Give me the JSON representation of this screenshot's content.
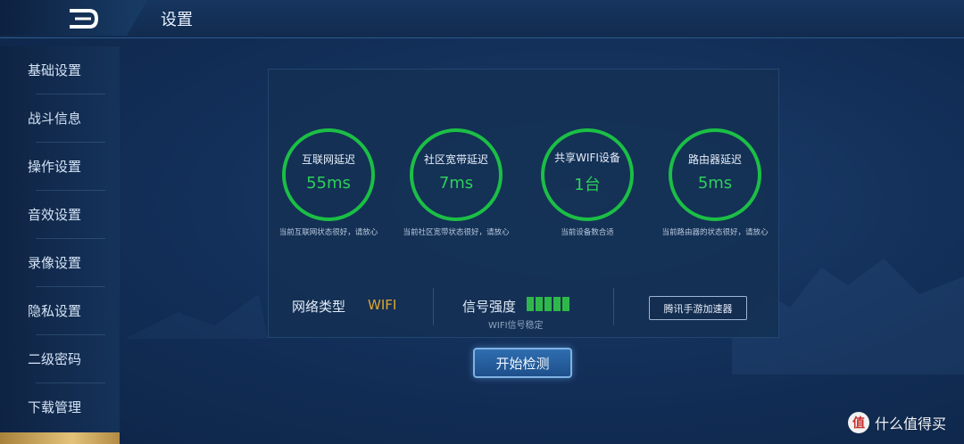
{
  "header": {
    "title": "设置",
    "back_icon": "back-arrow-icon"
  },
  "sidebar": {
    "items": [
      {
        "label": "基础设置"
      },
      {
        "label": "战斗信息"
      },
      {
        "label": "操作设置"
      },
      {
        "label": "音效设置"
      },
      {
        "label": "录像设置"
      },
      {
        "label": "隐私设置"
      },
      {
        "label": "二级密码"
      },
      {
        "label": "下载管理"
      }
    ]
  },
  "metrics": [
    {
      "label": "互联网延迟",
      "value": "55ms",
      "desc": "当前互联网状态很好，请放心"
    },
    {
      "label": "社区宽带延迟",
      "value": "7ms",
      "desc": "当前社区宽带状态很好，请放心"
    },
    {
      "label": "共享WIFI设备",
      "value": "1台",
      "desc": "当前设备数合适"
    },
    {
      "label": "路由器延迟",
      "value": "5ms",
      "desc": "当前路由器的状态很好，请放心"
    }
  ],
  "network": {
    "type_label": "网络类型",
    "type_value": "WIFI",
    "signal_label": "信号强度",
    "signal_bars": 5,
    "signal_sub": "WIFI信号稳定",
    "accelerator_button": "腾讯手游加速器"
  },
  "start_button": "开始检测",
  "watermark": {
    "logo": "值",
    "text": "什么值得买"
  },
  "colors": {
    "ring": "#1bbf45",
    "value": "#2bd05a",
    "wifi": "#e0a72f",
    "active_tab": "#e3c27a"
  }
}
